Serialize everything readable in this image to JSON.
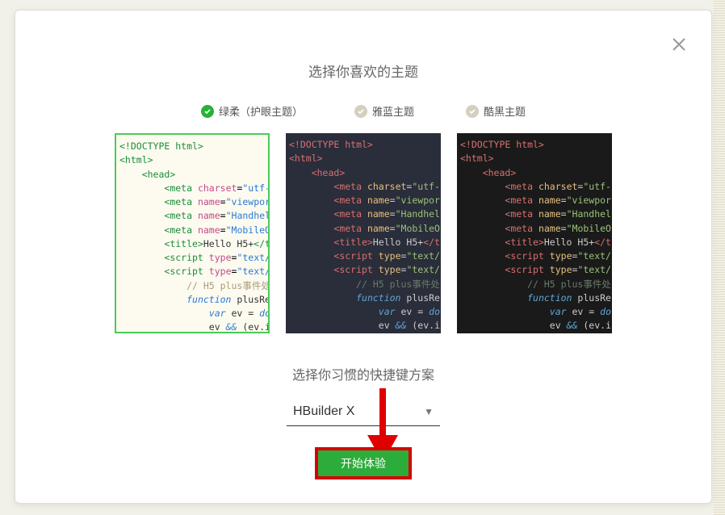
{
  "modal": {
    "title": "选择你喜欢的主题",
    "subtitle": "选择你习惯的快捷键方案",
    "themes": [
      {
        "label": "绿柔（护眼主题）",
        "active": true
      },
      {
        "label": "雅蓝主题",
        "active": false
      },
      {
        "label": "酷黑主题",
        "active": false
      }
    ],
    "select": {
      "value": "HBuilder X"
    },
    "start_button": "开始体验",
    "code_preview": {
      "lines": [
        "<!DOCTYPE html>",
        "<html>",
        "    <head>",
        "        <meta charset=\"utf-",
        "        <meta name=\"viewpor",
        "        <meta name=\"Handhel",
        "        <meta name=\"MobileO",
        "        <title>Hello H5+</t",
        "        <script type=\"text/",
        "        <script type=\"text/",
        "            // H5 plus事件处",
        "            function plusRe",
        "                var ev = do",
        "                ev && (ev.i"
      ]
    }
  }
}
